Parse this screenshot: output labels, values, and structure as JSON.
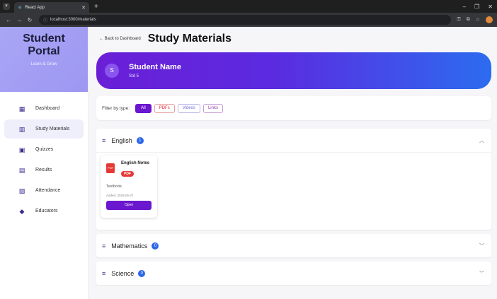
{
  "browser": {
    "tab_title": "React App",
    "url": "localhost:3000/materials"
  },
  "sidebar": {
    "brand_title_line1": "Student",
    "brand_title_line2": "Portal",
    "brand_subtitle": "Learn & Grow",
    "items": [
      {
        "label": "Dashboard",
        "icon": "dashboard-icon"
      },
      {
        "label": "Study Materials",
        "icon": "book-icon"
      },
      {
        "label": "Quizzes",
        "icon": "quiz-icon"
      },
      {
        "label": "Results",
        "icon": "chart-icon"
      },
      {
        "label": "Attendance",
        "icon": "calendar-icon"
      },
      {
        "label": "Educators",
        "icon": "graduation-cap-icon"
      }
    ]
  },
  "header": {
    "back_label": "Back to Dashboard",
    "title": "Study Materials"
  },
  "profile": {
    "initial": "S",
    "name": "Student Name",
    "sub": "Std 5"
  },
  "filter": {
    "label": "Filter by type:",
    "options": [
      "All",
      "PDFs",
      "Videos",
      "Links"
    ],
    "selected": "All"
  },
  "subjects": [
    {
      "name": "English",
      "count": "1",
      "expanded": true,
      "materials": [
        {
          "title": "English Notes",
          "badge": "PDF",
          "type": "Textbook",
          "date": "Added: 2025-05-27",
          "button": "Open"
        }
      ]
    },
    {
      "name": "Mathematics",
      "count": "0",
      "expanded": false
    },
    {
      "name": "Science",
      "count": "0",
      "expanded": false
    }
  ],
  "colors": {
    "accent": "#6b16cf",
    "brand_bg": "#a9a6f5",
    "badge_blue": "#2b66e8",
    "pdf_red": "#e53935"
  }
}
